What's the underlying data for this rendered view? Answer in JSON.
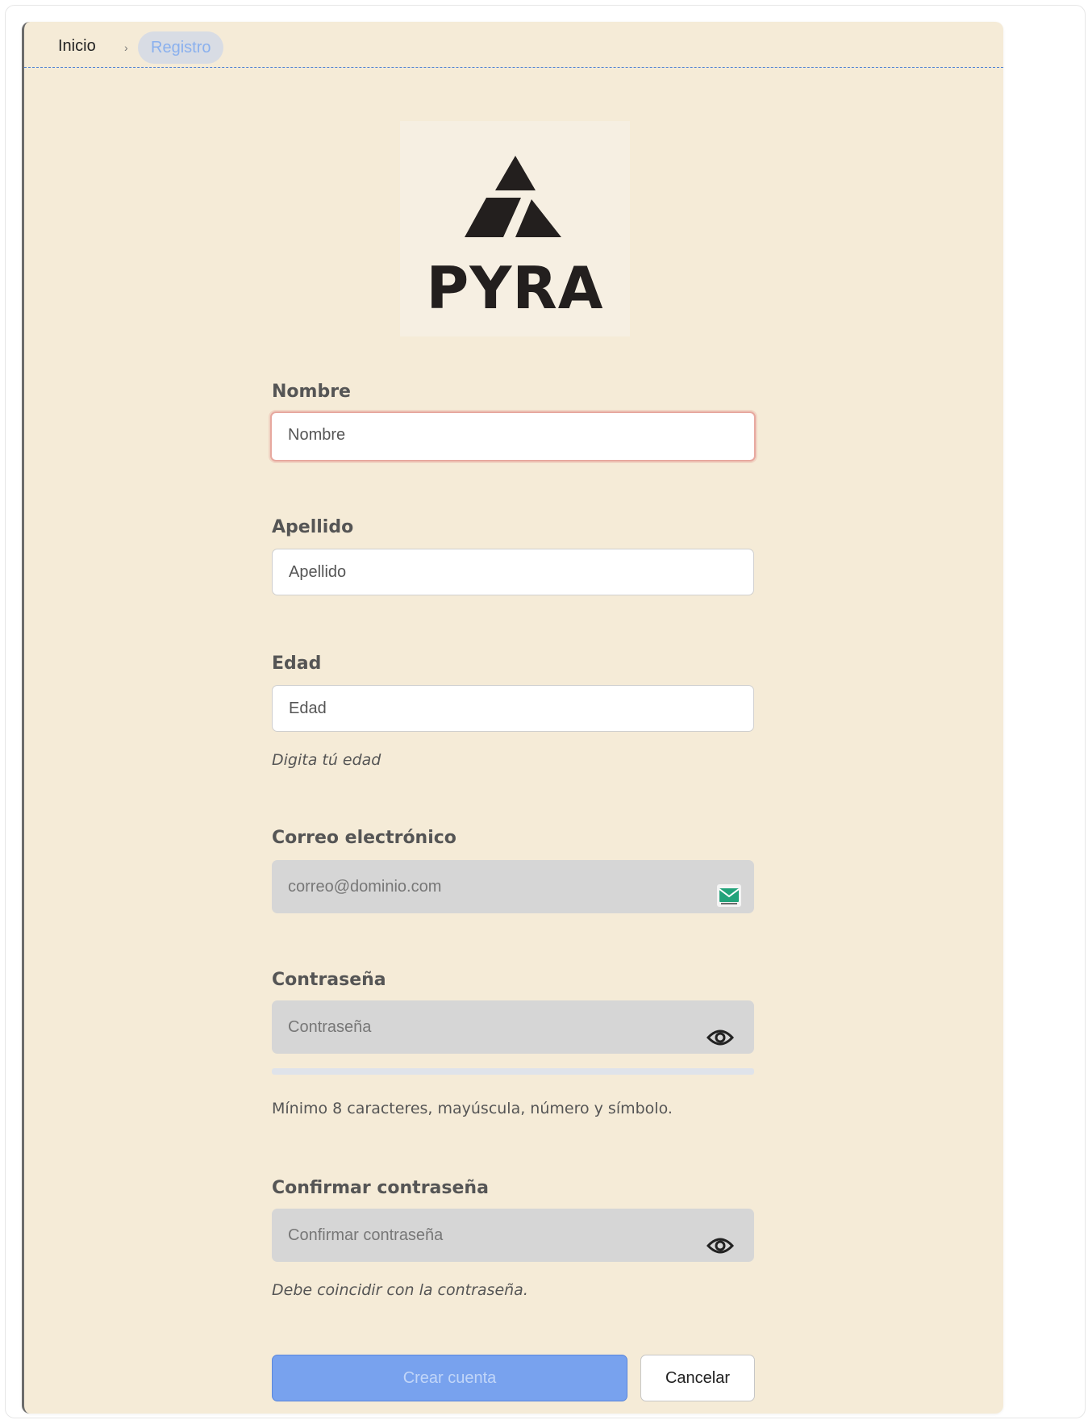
{
  "breadcrumb": {
    "home": "Inicio",
    "separator": "›",
    "current": "Registro"
  },
  "logo": {
    "text": "PYRA"
  },
  "form": {
    "nombre": {
      "label": "Nombre",
      "placeholder": "Nombre"
    },
    "apellido": {
      "label": "Apellido",
      "placeholder": "Apellido"
    },
    "edad": {
      "label": "Edad",
      "placeholder": "Edad",
      "help": "Digita tú edad"
    },
    "correo": {
      "label": "Correo electrónico",
      "placeholder": "correo@dominio.com",
      "icon": "email-icon"
    },
    "password": {
      "label": "Contraseña",
      "placeholder": "Contraseña",
      "icon": "eye-icon",
      "strength": 0,
      "help": "Mínimo 8 caracteres, mayúscula, número y símbolo."
    },
    "confirm": {
      "label": "Confirmar contraseña",
      "placeholder": "Confirmar contraseña",
      "icon": "eye-icon",
      "help": "Debe coincidir con la contraseña."
    }
  },
  "actions": {
    "submit": "Crear cuenta",
    "cancel": "Cancelar"
  },
  "colors": {
    "card_background": "#f5ebd7",
    "primary": "#78a2ee",
    "focus_border": "#e7a89f",
    "breadcrumb_active": "#8ab0ee"
  }
}
